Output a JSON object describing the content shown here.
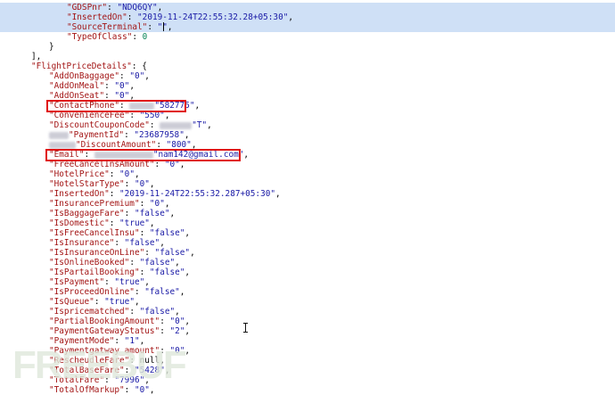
{
  "watermark": "FREEBUF",
  "lines": [
    {
      "sel": true,
      "k": "\"GDSPnr\"",
      "v": "\"NDQ6QY\"",
      "vt": "s",
      "tail": ","
    },
    {
      "sel": true,
      "k": "\"InsertedOn\"",
      "v": "\"2019-11-24T22:55:32.28+05:30\"",
      "vt": "s",
      "tail": ","
    },
    {
      "sel": true,
      "k": "\"SourceTerminal\"",
      "v": "\"\"",
      "vt": "s",
      "tail": ","
    },
    {
      "sel": false,
      "k": "\"TypeOfClass\"",
      "v": "0",
      "vt": "n",
      "tail": ""
    },
    {
      "sel": false,
      "plain": "}"
    },
    {
      "sel": false,
      "plain": "],"
    },
    {
      "sel": false,
      "k": "\"FlightPriceDetails\"",
      "v": "{",
      "vt": "p",
      "tail": ""
    },
    {
      "k": "\"AddOnBaggage\"",
      "v": "\"0\"",
      "vt": "s",
      "tail": ","
    },
    {
      "k": "\"AddOnMeal\"",
      "v": "\"0\"",
      "vt": "s",
      "tail": ","
    },
    {
      "k": "\"AddOnSeat\"",
      "v": "\"0\"",
      "vt": "s",
      "tail": ","
    },
    {
      "k": "\"ContactPhone\"",
      "v": "\"582775\"",
      "vt": "s",
      "tail": ",",
      "blurPrefix": 28
    },
    {
      "k": "\"ConvenienceFee\"",
      "v": "\"550\"",
      "vt": "s",
      "tail": ","
    },
    {
      "k": "\"DiscountCouponCode\"",
      "v": "\"T\"",
      "vt": "s",
      "tail": ",",
      "blurPrefix": 36
    },
    {
      "k": "\"PaymentId\"",
      "v": "\"23687958\"",
      "vt": "s",
      "tail": ",",
      "blurKey": 22
    },
    {
      "k": "\"DiscountAmount\"",
      "v": "\"800\"",
      "vt": "s",
      "tail": ",",
      "blurKey": 30
    },
    {
      "k": "\"Email\"",
      "v": "\"nam142@gmail.com\"",
      "vt": "s",
      "tail": ",",
      "blurPrefix": 66
    },
    {
      "k": "\"FreeCancelInsAmount\"",
      "v": "\"0\"",
      "vt": "s",
      "tail": ","
    },
    {
      "k": "\"HotelPrice\"",
      "v": "\"0\"",
      "vt": "s",
      "tail": ","
    },
    {
      "k": "\"HotelStarType\"",
      "v": "\"0\"",
      "vt": "s",
      "tail": ","
    },
    {
      "k": "\"InsertedOn\"",
      "v": "\"2019-11-24T22:55:32.287+05:30\"",
      "vt": "s",
      "tail": ","
    },
    {
      "k": "\"InsurancePremium\"",
      "v": "\"0\"",
      "vt": "s",
      "tail": ","
    },
    {
      "k": "\"IsBaggageFare\"",
      "v": "\"false\"",
      "vt": "s",
      "tail": ","
    },
    {
      "k": "\"IsDomestic\"",
      "v": "\"true\"",
      "vt": "s",
      "tail": ","
    },
    {
      "k": "\"IsFreeCancelInsu\"",
      "v": "\"false\"",
      "vt": "s",
      "tail": ","
    },
    {
      "k": "\"IsInsurance\"",
      "v": "\"false\"",
      "vt": "s",
      "tail": ","
    },
    {
      "k": "\"IsInsuranceOnLine\"",
      "v": "\"false\"",
      "vt": "s",
      "tail": ","
    },
    {
      "k": "\"IsOnlineBooked\"",
      "v": "\"false\"",
      "vt": "s",
      "tail": ","
    },
    {
      "k": "\"IsPartailBooking\"",
      "v": "\"false\"",
      "vt": "s",
      "tail": ","
    },
    {
      "k": "\"IsPayment\"",
      "v": "\"true\"",
      "vt": "s",
      "tail": ","
    },
    {
      "k": "\"IsProceedOnline\"",
      "v": "\"false\"",
      "vt": "s",
      "tail": ","
    },
    {
      "k": "\"IsQueue\"",
      "v": "\"true\"",
      "vt": "s",
      "tail": ","
    },
    {
      "k": "\"Ispricematched\"",
      "v": "\"false\"",
      "vt": "s",
      "tail": ","
    },
    {
      "k": "\"PartialBookingAmount\"",
      "v": "\"0\"",
      "vt": "s",
      "tail": ","
    },
    {
      "k": "\"PaymentGatewayStatus\"",
      "v": "\"2\"",
      "vt": "s",
      "tail": ","
    },
    {
      "k": "\"PaymentMode\"",
      "v": "\"1\"",
      "vt": "s",
      "tail": ","
    },
    {
      "k": "\"Paymentgatway_amount\"",
      "v": "\"0\"",
      "vt": "s",
      "tail": ","
    },
    {
      "k": "\"RescheudleFare\"",
      "v": "null",
      "vt": "p",
      "tail": ","
    },
    {
      "k": "\"TotalBaseFare\"",
      "v": "\"5428\"",
      "vt": "s",
      "tail": ","
    },
    {
      "k": "\"TotalFare\"",
      "v": "\"7996\"",
      "vt": "s",
      "tail": ","
    },
    {
      "k": "\"TotalOfMarkup\"",
      "v": "\"0\"",
      "vt": "s",
      "tail": ","
    }
  ]
}
